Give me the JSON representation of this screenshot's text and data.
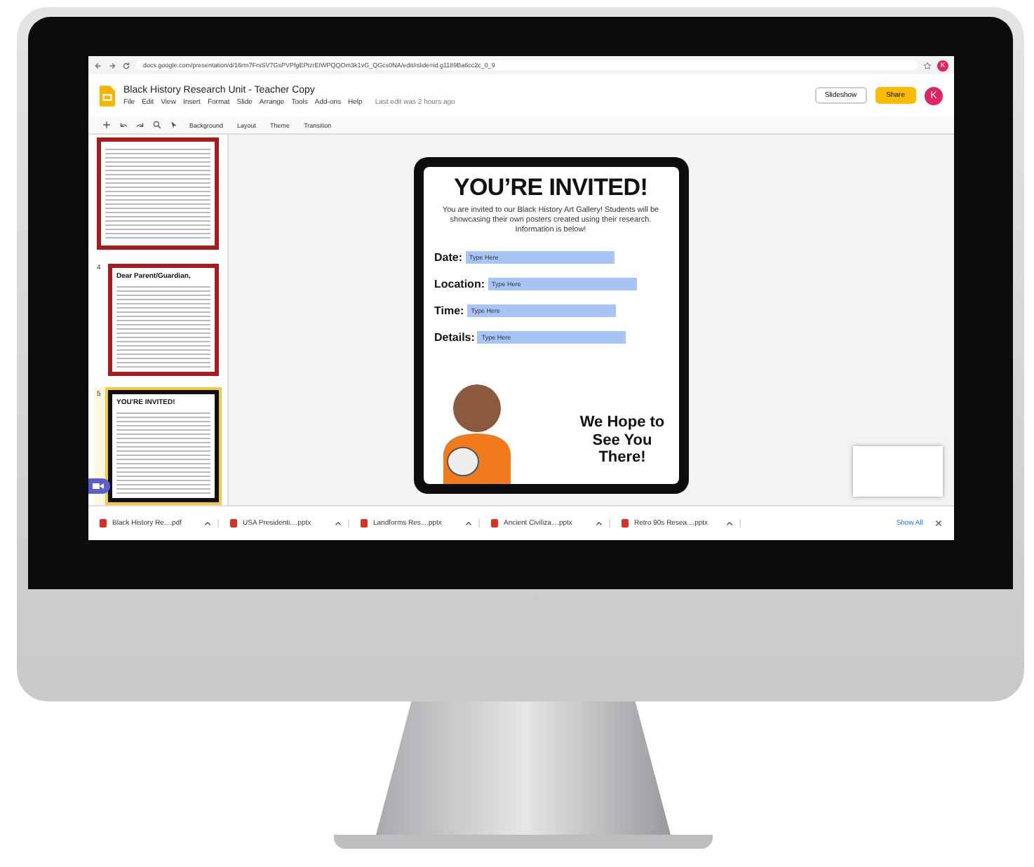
{
  "browser": {
    "url": "docs.google.com/presentation/d/16rm7FrsSV7GsPVPfgEPtzrEIWPQQOm3k1vG_QGcs0NA/edit#slide=id.g1189Ba6cc2c_0_9"
  },
  "docs": {
    "title": "Black History Research Unit - Teacher Copy",
    "menu": [
      "File",
      "Edit",
      "View",
      "Insert",
      "Format",
      "Slide",
      "Arrange",
      "Tools",
      "Add-ons",
      "Help"
    ],
    "last_edit": "Last edit was 2 hours ago",
    "slideshow_button": "Slideshow",
    "share_button": "Share",
    "avatar": "K",
    "browser_avatar": "K"
  },
  "toolbar": {
    "items": [
      "Background",
      "Layout",
      "Theme",
      "Transition"
    ]
  },
  "filmstrip": [
    {
      "selected": false
    },
    {
      "number": "4",
      "title": "Dear Parent/Guardian,",
      "selected": false
    },
    {
      "number": "5",
      "title": "YOU'RE INVITED!",
      "selected": true
    }
  ],
  "slide": {
    "title": "YOU’RE INVITED!",
    "intro": "You are invited to our Black History Art Gallery! Students will be showcasing their own posters created using their research. Information is below!",
    "fields": [
      {
        "label": "Date:",
        "value": "Type Here"
      },
      {
        "label": "Location:",
        "value": "Type Here"
      },
      {
        "label": "Time:",
        "value": "Type Here"
      },
      {
        "label": "Details:",
        "value": "Type Here"
      }
    ],
    "closing": "We Hope to See You There!"
  },
  "downloads": {
    "items": [
      "Black History Re....pdf",
      "USA Presidenti....pptx",
      "Landforms Res....pptx",
      "Ancient Civiliza....pptx",
      "Retro 90s Resea....pptx"
    ],
    "show_all": "Show All"
  }
}
